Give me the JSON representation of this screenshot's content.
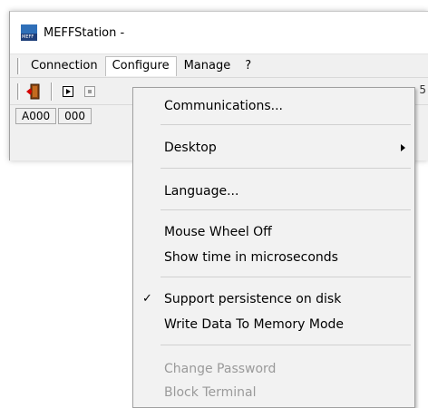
{
  "window": {
    "title": "MEFFStation -",
    "icon_text": "MEFF",
    "icon": "meff-app-icon"
  },
  "menubar": {
    "items": [
      "Connection",
      "Configure",
      "Manage",
      "?"
    ]
  },
  "toolbar": {
    "icons": [
      "exit-door-icon",
      "play-icon",
      "stop-icon"
    ],
    "right_fragment": "5"
  },
  "status": {
    "cells": [
      "A000",
      "000"
    ]
  },
  "configure_menu": {
    "items": [
      {
        "label": "Communications...",
        "enabled": true
      },
      {
        "label": "Desktop",
        "enabled": true,
        "submenu": true
      },
      {
        "label": "Language...",
        "enabled": true
      },
      {
        "label": "Mouse Wheel Off",
        "enabled": true
      },
      {
        "label": "Show time in microseconds",
        "enabled": true
      },
      {
        "label": "Support persistence on disk",
        "enabled": true,
        "checked": true
      },
      {
        "label": "Write Data To Memory Mode",
        "enabled": true
      },
      {
        "label": "Change Password",
        "enabled": false
      },
      {
        "label": "Block Terminal",
        "enabled": false
      }
    ],
    "check_glyph": "✓"
  }
}
